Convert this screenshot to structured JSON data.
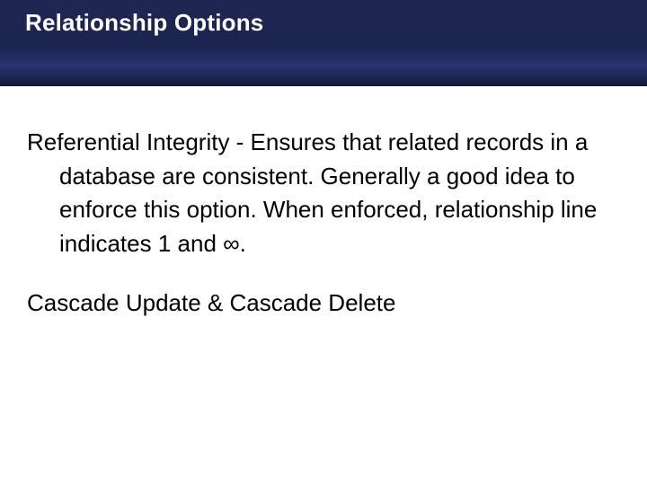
{
  "slide": {
    "title": "Relationship Options",
    "paragraph1": "Referential Integrity - Ensures that related records in a database are consistent.  Generally a good idea to enforce this option.  When enforced, relationship line indicates 1 and ∞.",
    "paragraph2": "Cascade Update & Cascade Delete"
  }
}
